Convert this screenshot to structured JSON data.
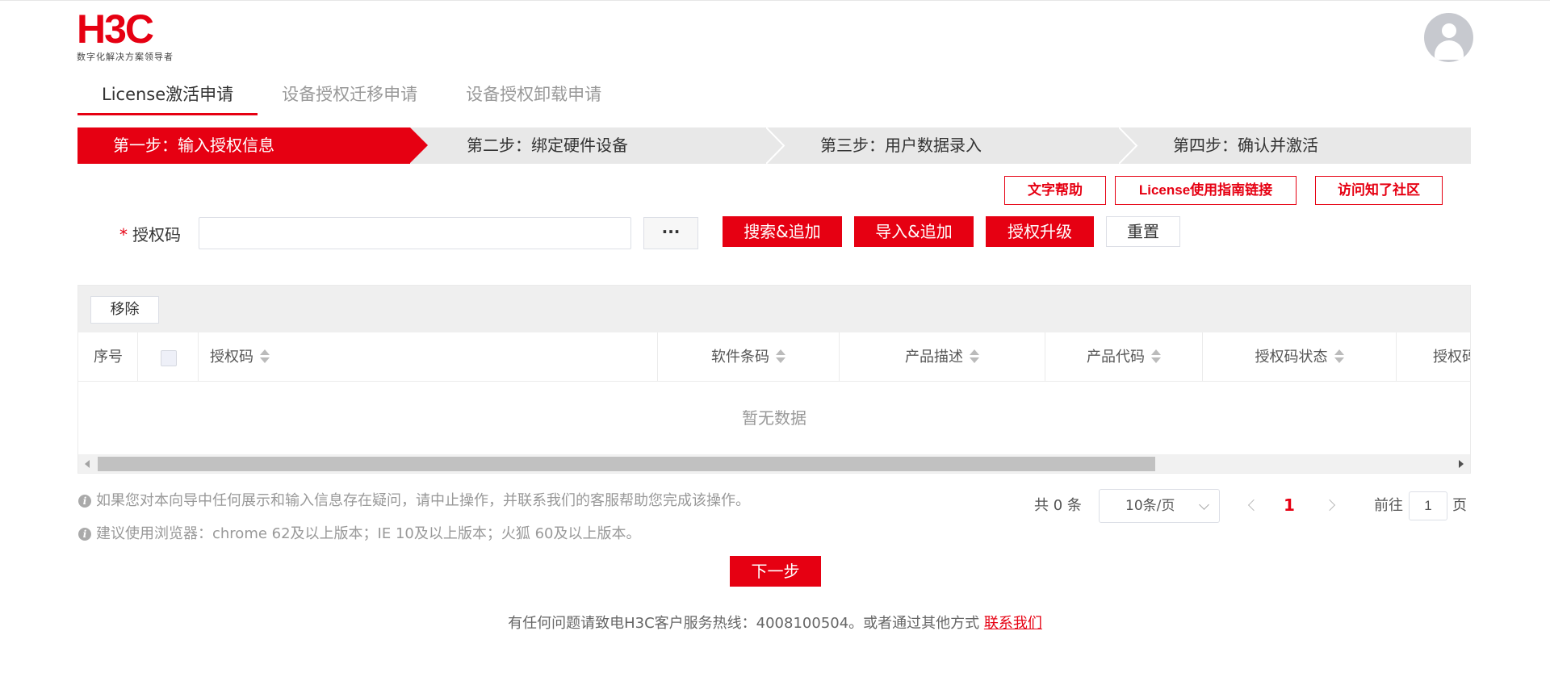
{
  "brand": {
    "logo": "H3C",
    "tagline": "数字化解决方案领导者",
    "accent": "#e60012"
  },
  "tabs": [
    {
      "label": "License激活申请",
      "active": true
    },
    {
      "label": "设备授权迁移申请",
      "active": false
    },
    {
      "label": "设备授权卸载申请",
      "active": false
    }
  ],
  "steps": [
    {
      "label": "第一步：输入授权信息",
      "active": true
    },
    {
      "label": "第二步：绑定硬件设备",
      "active": false
    },
    {
      "label": "第三步：用户数据录入",
      "active": false
    },
    {
      "label": "第四步：确认并激活",
      "active": false
    }
  ],
  "help_links": {
    "text_help": "文字帮助",
    "guide": "License使用指南链接",
    "community": "访问知了社区"
  },
  "form": {
    "required_mark": "*",
    "code_label": "授权码",
    "code_value": "",
    "more_label": "···",
    "search_add": "搜索&追加",
    "import_add": "导入&追加",
    "upgrade": "授权升级",
    "reset": "重置"
  },
  "table": {
    "remove_label": "移除",
    "columns": [
      "序号",
      "授权码",
      "软件条码",
      "产品描述",
      "产品代码",
      "授权码状态",
      "授权码"
    ],
    "empty_text": "暂无数据"
  },
  "notes": [
    "如果您对本向导中任何展示和输入信息存在疑问，请中止操作，并联系我们的客服帮助您完成该操作。",
    "建议使用浏览器：chrome 62及以上版本；IE 10及以上版本；火狐 60及以上版本。"
  ],
  "pagination": {
    "total_text": "共 0 条",
    "page_size": "10条/页",
    "current_page": "1",
    "goto_label": "前往",
    "goto_value": "1",
    "page_suffix": "页"
  },
  "next_label": "下一步",
  "footer": {
    "text": "有任何问题请致电H3C客户服务热线：4008100504。或者通过其他方式 ",
    "link": "联系我们"
  }
}
